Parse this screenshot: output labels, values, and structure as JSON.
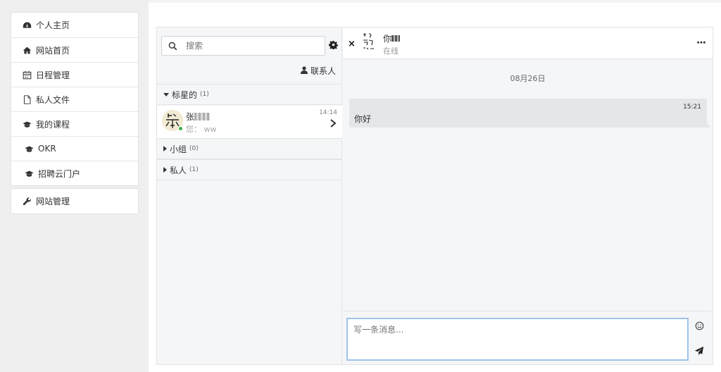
{
  "sidebar": {
    "items": [
      {
        "label": "个人主页",
        "icon": "dashboard-icon"
      },
      {
        "label": "网站首页",
        "icon": "home-icon"
      },
      {
        "label": "日程管理",
        "icon": "calendar-icon"
      },
      {
        "label": "私人文件",
        "icon": "file-icon"
      },
      {
        "label": "我的课程",
        "icon": "graduation-cap-icon"
      },
      {
        "label": "OKR",
        "icon": "graduation-cap-icon"
      },
      {
        "label": "招聘云门户",
        "icon": "graduation-cap-icon"
      }
    ],
    "admin_item": {
      "label": "网站管理",
      "icon": "wrench-icon"
    }
  },
  "chat": {
    "search": {
      "placeholder": "搜索"
    },
    "contacts_label": "联系人",
    "groups": [
      {
        "label": "标星的",
        "count": "(1)",
        "expanded": true
      },
      {
        "label": "小组",
        "count": "(0)",
        "expanded": false
      },
      {
        "label": "私人",
        "count": "(1)",
        "expanded": false
      }
    ],
    "starred_contact": {
      "name_prefix": "张",
      "preview": "您： ww",
      "time": "14:14",
      "status_color": "#3fae49"
    },
    "conversation": {
      "close_label": "×",
      "name_prefix": "你",
      "status": "在线",
      "more_label": "···",
      "date": "08月26日",
      "messages": [
        {
          "time": "15:21",
          "text": "你好"
        }
      ],
      "composer_placeholder": "写一条消息..."
    }
  },
  "colors": {
    "online": "#3fae49",
    "input_border_focus": "#9ec3ea",
    "bubble": "#e4e6ea"
  }
}
